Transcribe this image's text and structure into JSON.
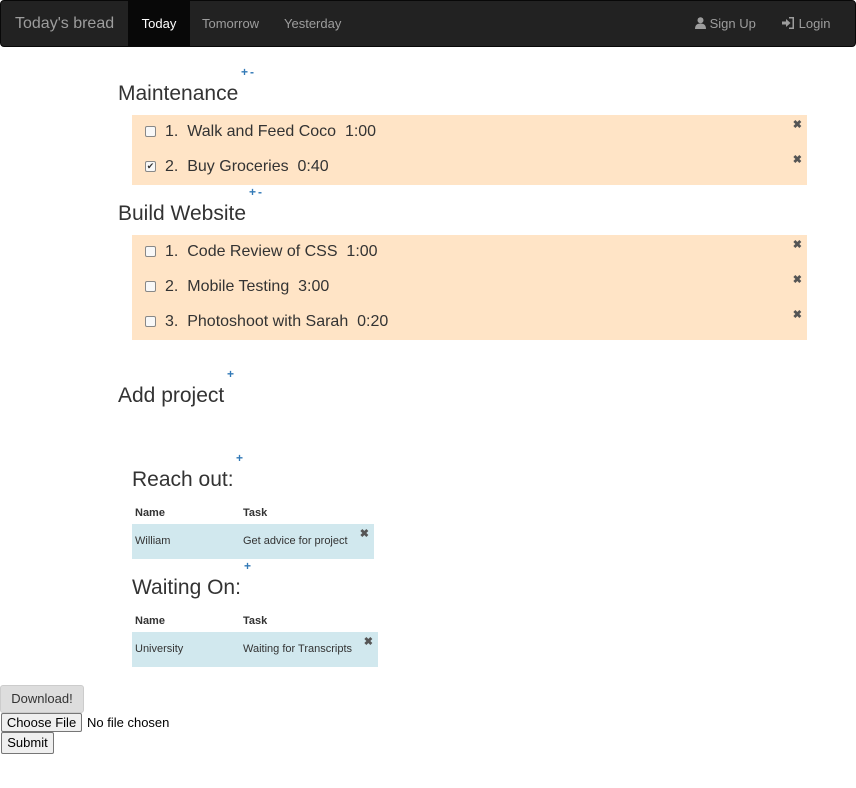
{
  "navbar": {
    "brand": "Today's bread",
    "tabs": [
      {
        "label": "Today"
      },
      {
        "label": "Tomorrow"
      },
      {
        "label": "Yesterday"
      }
    ],
    "signup_label": "Sign Up",
    "login_label": "Login"
  },
  "projects": [
    {
      "title": "Maintenance",
      "tasks": [
        {
          "text": "1.  Walk and Feed Coco  1:00",
          "checked": false
        },
        {
          "text": "2.  Buy Groceries  0:40",
          "checked": true
        }
      ]
    },
    {
      "title": "Build Website",
      "tasks": [
        {
          "text": "1.  Code Review of CSS  1:00",
          "checked": false
        },
        {
          "text": "2.  Mobile Testing  3:00",
          "checked": false
        },
        {
          "text": "3.  Photoshoot with Sarah  0:20",
          "checked": false
        }
      ]
    }
  ],
  "controls": {
    "plus": "+",
    "minus": "-"
  },
  "add_project": "Add project",
  "reach_out": {
    "title": "Reach out:",
    "col_name": "Name",
    "col_task": "Task",
    "rows": [
      {
        "name": "William",
        "task": "Get advice for project"
      }
    ]
  },
  "waiting_on": {
    "title": "Waiting On:",
    "col_name": "Name",
    "col_task": "Task",
    "rows": [
      {
        "name": "University",
        "task": "Waiting for Transcripts"
      }
    ]
  },
  "download_label": "Download!",
  "file_input": {
    "button": "Choose File",
    "status": "No file chosen"
  },
  "submit_label": "Submit",
  "colors": {
    "navbar": "#222222",
    "task_bg": "#ffe4c6",
    "table_row_bg": "#d1e8ee",
    "link": "#337ab7"
  },
  "icons": {
    "remove": "remove-icon",
    "user": "user-icon",
    "login": "login-icon"
  }
}
